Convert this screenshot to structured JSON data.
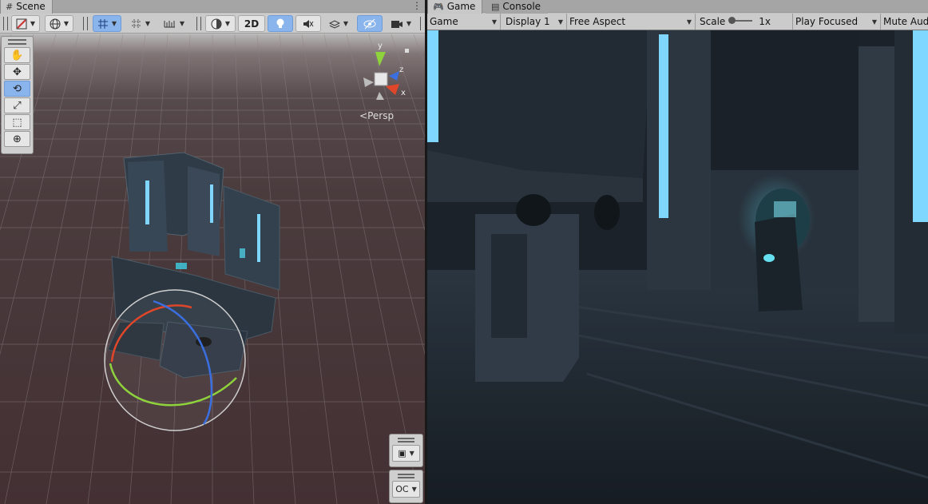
{
  "scene_panel": {
    "tab_label": "Scene",
    "tab_icon": "hash-grid-icon",
    "toolbar": {
      "btn_2d": "2D"
    },
    "gizmo": {
      "projection_label": "Persp",
      "axis_y": "y",
      "axis_z": "z",
      "axis_x": "x"
    },
    "tools": [
      "view-hand-tool",
      "move-tool",
      "rotate-tool",
      "scale-tool",
      "rect-tool",
      "transform-tool"
    ],
    "overlay_oc_label": "OC"
  },
  "game_panel": {
    "tabs": [
      {
        "label": "Game",
        "icon": "gamepad-icon",
        "active": true
      },
      {
        "label": "Console",
        "icon": "console-icon",
        "active": false
      }
    ],
    "toolbar": {
      "mode": "Game",
      "display": "Display 1",
      "aspect": "Free Aspect",
      "scale_label": "Scale",
      "scale_value": "1x",
      "play_mode": "Play Focused",
      "mute": "Mute Aud"
    }
  },
  "colors": {
    "accent_selected": "#8ab4ec",
    "axis_x": "#e0462a",
    "axis_y": "#8ed23c",
    "axis_z": "#3b6fe0",
    "light_strip": "#7fd7ff"
  }
}
